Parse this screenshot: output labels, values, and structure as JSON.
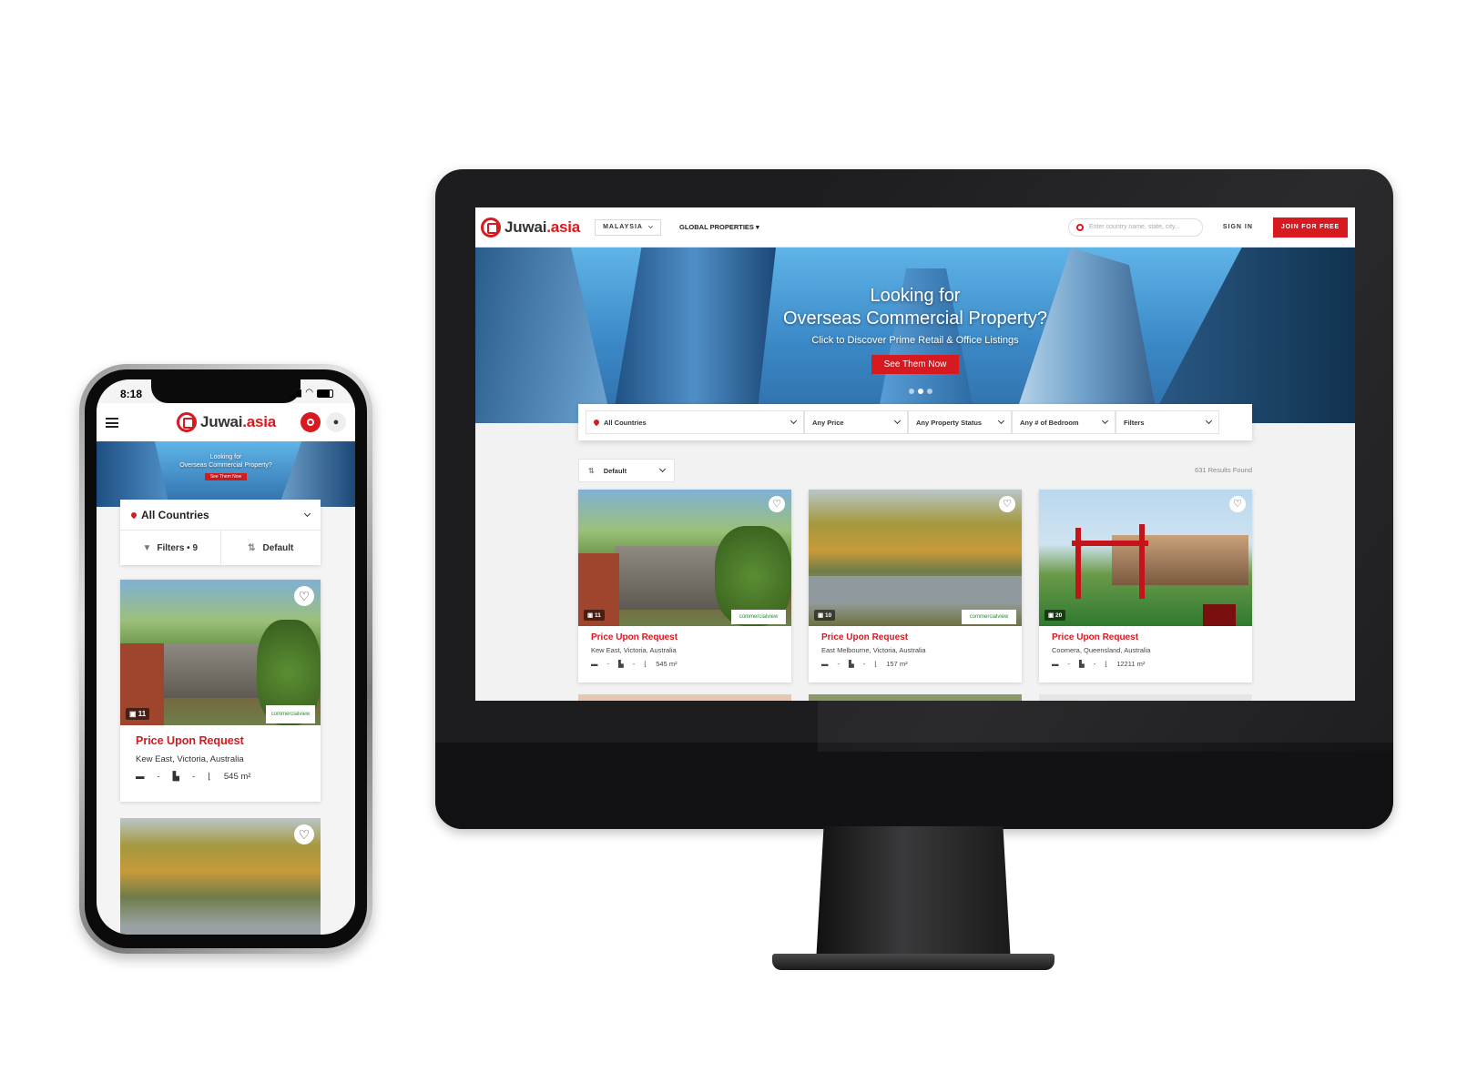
{
  "brand": {
    "name_main": "Juwai",
    "name_tld": ".asia",
    "accent": "#d71920"
  },
  "desktop": {
    "header": {
      "country": "MALAYSIA",
      "global_nav": "GLOBAL PROPERTIES",
      "search_placeholder": "Enter country name, state, city...",
      "sign_in": "SIGN IN",
      "join": "JOIN FOR FREE"
    },
    "hero": {
      "line1": "Looking for",
      "line2": "Overseas Commercial Property?",
      "line3": "Click to Discover Prime Retail & Office Listings",
      "button": "See Them Now"
    },
    "filters": {
      "country": "All Countries",
      "price": "Any Price",
      "status": "Any Property Status",
      "bedroom": "Any # of Bedroom",
      "more": "Filters"
    },
    "sort": "Default",
    "results": "631 Results Found",
    "listings": [
      {
        "price": "Price Upon Request",
        "location": "Kew East, Victoria, Australia",
        "photos": "11",
        "beds": "-",
        "baths": "-",
        "area": "545 m²",
        "agency": "commercialview"
      },
      {
        "price": "Price Upon Request",
        "location": "East Melbourne, Victoria, Australia",
        "photos": "10",
        "beds": "-",
        "baths": "-",
        "area": "157 m²",
        "agency": "commercialview"
      },
      {
        "price": "Price Upon Request",
        "location": "Coomera, Queensland, Australia",
        "photos": "20",
        "beds": "-",
        "baths": "-",
        "area": "12211 m²"
      }
    ]
  },
  "mobile": {
    "status_time": "8:18",
    "hero": {
      "line1": "Looking for",
      "line2": "Overseas Commercial Property?",
      "button": "See Them Now"
    },
    "country": "All Countries",
    "filters": "Filters • 9",
    "sort": "Default",
    "listing": {
      "price": "Price Upon Request",
      "location": "Kew East, Victoria, Australia",
      "photos": "11",
      "beds": "-",
      "baths": "-",
      "area": "545 m²",
      "agency": "commercialview"
    }
  }
}
